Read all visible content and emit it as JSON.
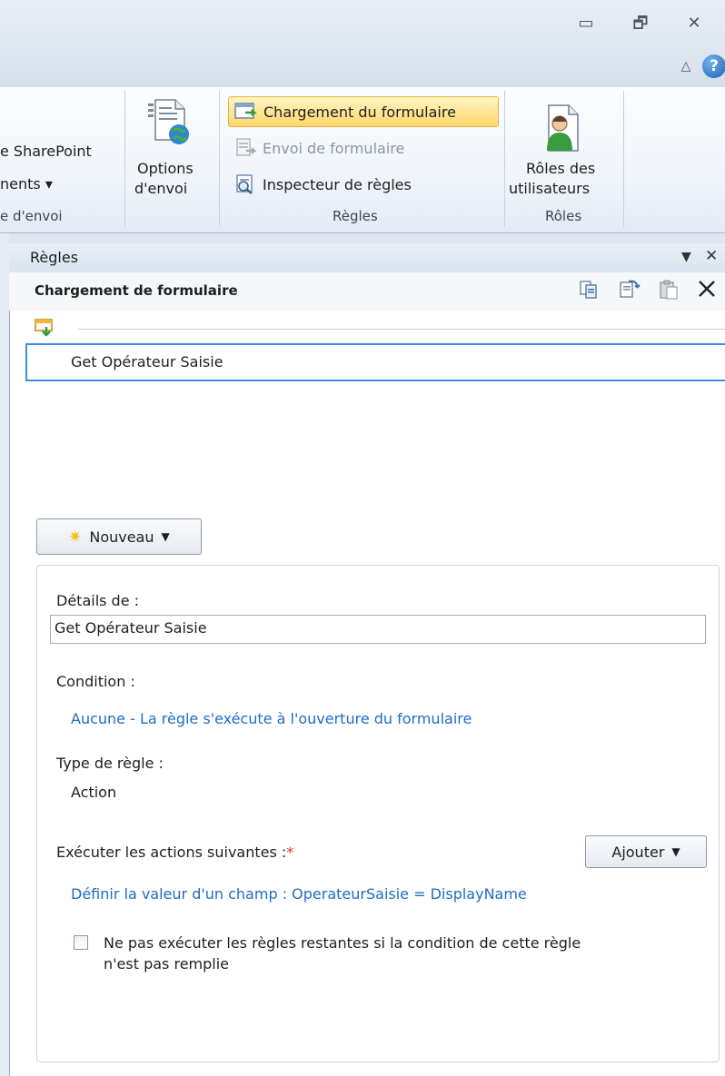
{
  "window": {
    "minimize_glyph": "▭",
    "restore_glyph": "🗗",
    "close_glyph": "✕",
    "help_glyph": "?"
  },
  "ribbon": {
    "partial_group": {
      "item1": "e SharePoint",
      "item2": "nents ▾",
      "label": "e d'envoi"
    },
    "options_envoi": {
      "line1": "Options",
      "line2": "d'envoi"
    },
    "regles_group": {
      "label": "Règles",
      "chargement": "Chargement du formulaire",
      "envoi": "Envoi de formulaire",
      "inspecteur": "Inspecteur de règles"
    },
    "roles_group": {
      "label": "Rôles",
      "line1": "Rôles des",
      "line2": "utilisateurs"
    }
  },
  "pane": {
    "title": "Règles",
    "subtitle": "Chargement de formulaire",
    "rules": [
      {
        "name": "Get Opérateur Saisie"
      }
    ],
    "new_button": "Nouveau",
    "details": {
      "details_label": "Détails de :",
      "name_value": "Get Opérateur Saisie",
      "condition_label": "Condition :",
      "condition_link": "Aucune - La règle s'exécute à l'ouverture du formulaire",
      "type_label": "Type de règle :",
      "type_value": "Action",
      "actions_label": "Exécuter les actions suivantes :",
      "required_mark": "*",
      "add_button": "Ajouter",
      "action_link": "Définir la valeur d'un champ : OperateurSaisie = DisplayName",
      "stop_rules_line1": "Ne pas exécuter les règles restantes si la condition de cette règle",
      "stop_rules_line2": "n'est pas remplie",
      "stop_rules_checked": false
    }
  }
}
